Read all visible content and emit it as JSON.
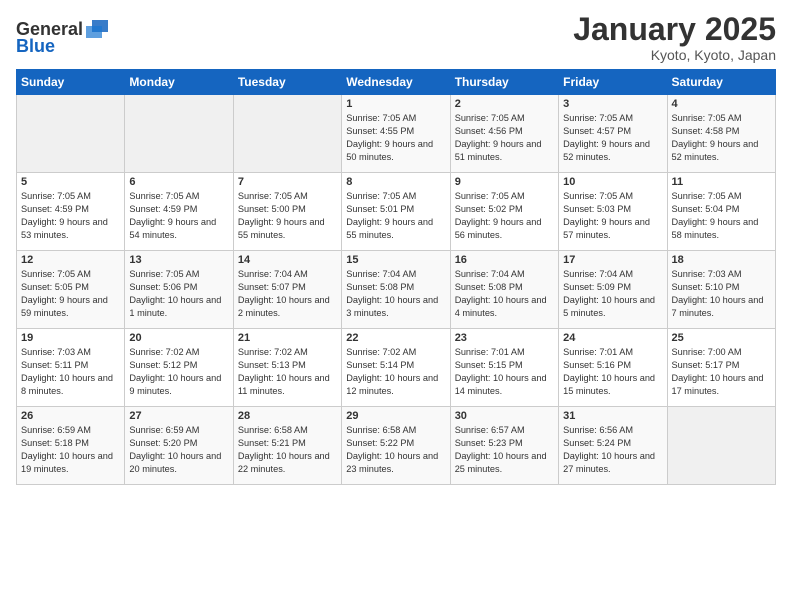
{
  "logo": {
    "line1": "General",
    "line2": "Blue"
  },
  "header": {
    "title": "January 2025",
    "location": "Kyoto, Kyoto, Japan"
  },
  "weekdays": [
    "Sunday",
    "Monday",
    "Tuesday",
    "Wednesday",
    "Thursday",
    "Friday",
    "Saturday"
  ],
  "weeks": [
    [
      {
        "day": "",
        "sunrise": "",
        "sunset": "",
        "daylight": ""
      },
      {
        "day": "",
        "sunrise": "",
        "sunset": "",
        "daylight": ""
      },
      {
        "day": "",
        "sunrise": "",
        "sunset": "",
        "daylight": ""
      },
      {
        "day": "1",
        "sunrise": "Sunrise: 7:05 AM",
        "sunset": "Sunset: 4:55 PM",
        "daylight": "Daylight: 9 hours and 50 minutes."
      },
      {
        "day": "2",
        "sunrise": "Sunrise: 7:05 AM",
        "sunset": "Sunset: 4:56 PM",
        "daylight": "Daylight: 9 hours and 51 minutes."
      },
      {
        "day": "3",
        "sunrise": "Sunrise: 7:05 AM",
        "sunset": "Sunset: 4:57 PM",
        "daylight": "Daylight: 9 hours and 52 minutes."
      },
      {
        "day": "4",
        "sunrise": "Sunrise: 7:05 AM",
        "sunset": "Sunset: 4:58 PM",
        "daylight": "Daylight: 9 hours and 52 minutes."
      }
    ],
    [
      {
        "day": "5",
        "sunrise": "Sunrise: 7:05 AM",
        "sunset": "Sunset: 4:59 PM",
        "daylight": "Daylight: 9 hours and 53 minutes."
      },
      {
        "day": "6",
        "sunrise": "Sunrise: 7:05 AM",
        "sunset": "Sunset: 4:59 PM",
        "daylight": "Daylight: 9 hours and 54 minutes."
      },
      {
        "day": "7",
        "sunrise": "Sunrise: 7:05 AM",
        "sunset": "Sunset: 5:00 PM",
        "daylight": "Daylight: 9 hours and 55 minutes."
      },
      {
        "day": "8",
        "sunrise": "Sunrise: 7:05 AM",
        "sunset": "Sunset: 5:01 PM",
        "daylight": "Daylight: 9 hours and 55 minutes."
      },
      {
        "day": "9",
        "sunrise": "Sunrise: 7:05 AM",
        "sunset": "Sunset: 5:02 PM",
        "daylight": "Daylight: 9 hours and 56 minutes."
      },
      {
        "day": "10",
        "sunrise": "Sunrise: 7:05 AM",
        "sunset": "Sunset: 5:03 PM",
        "daylight": "Daylight: 9 hours and 57 minutes."
      },
      {
        "day": "11",
        "sunrise": "Sunrise: 7:05 AM",
        "sunset": "Sunset: 5:04 PM",
        "daylight": "Daylight: 9 hours and 58 minutes."
      }
    ],
    [
      {
        "day": "12",
        "sunrise": "Sunrise: 7:05 AM",
        "sunset": "Sunset: 5:05 PM",
        "daylight": "Daylight: 9 hours and 59 minutes."
      },
      {
        "day": "13",
        "sunrise": "Sunrise: 7:05 AM",
        "sunset": "Sunset: 5:06 PM",
        "daylight": "Daylight: 10 hours and 1 minute."
      },
      {
        "day": "14",
        "sunrise": "Sunrise: 7:04 AM",
        "sunset": "Sunset: 5:07 PM",
        "daylight": "Daylight: 10 hours and 2 minutes."
      },
      {
        "day": "15",
        "sunrise": "Sunrise: 7:04 AM",
        "sunset": "Sunset: 5:08 PM",
        "daylight": "Daylight: 10 hours and 3 minutes."
      },
      {
        "day": "16",
        "sunrise": "Sunrise: 7:04 AM",
        "sunset": "Sunset: 5:08 PM",
        "daylight": "Daylight: 10 hours and 4 minutes."
      },
      {
        "day": "17",
        "sunrise": "Sunrise: 7:04 AM",
        "sunset": "Sunset: 5:09 PM",
        "daylight": "Daylight: 10 hours and 5 minutes."
      },
      {
        "day": "18",
        "sunrise": "Sunrise: 7:03 AM",
        "sunset": "Sunset: 5:10 PM",
        "daylight": "Daylight: 10 hours and 7 minutes."
      }
    ],
    [
      {
        "day": "19",
        "sunrise": "Sunrise: 7:03 AM",
        "sunset": "Sunset: 5:11 PM",
        "daylight": "Daylight: 10 hours and 8 minutes."
      },
      {
        "day": "20",
        "sunrise": "Sunrise: 7:02 AM",
        "sunset": "Sunset: 5:12 PM",
        "daylight": "Daylight: 10 hours and 9 minutes."
      },
      {
        "day": "21",
        "sunrise": "Sunrise: 7:02 AM",
        "sunset": "Sunset: 5:13 PM",
        "daylight": "Daylight: 10 hours and 11 minutes."
      },
      {
        "day": "22",
        "sunrise": "Sunrise: 7:02 AM",
        "sunset": "Sunset: 5:14 PM",
        "daylight": "Daylight: 10 hours and 12 minutes."
      },
      {
        "day": "23",
        "sunrise": "Sunrise: 7:01 AM",
        "sunset": "Sunset: 5:15 PM",
        "daylight": "Daylight: 10 hours and 14 minutes."
      },
      {
        "day": "24",
        "sunrise": "Sunrise: 7:01 AM",
        "sunset": "Sunset: 5:16 PM",
        "daylight": "Daylight: 10 hours and 15 minutes."
      },
      {
        "day": "25",
        "sunrise": "Sunrise: 7:00 AM",
        "sunset": "Sunset: 5:17 PM",
        "daylight": "Daylight: 10 hours and 17 minutes."
      }
    ],
    [
      {
        "day": "26",
        "sunrise": "Sunrise: 6:59 AM",
        "sunset": "Sunset: 5:18 PM",
        "daylight": "Daylight: 10 hours and 19 minutes."
      },
      {
        "day": "27",
        "sunrise": "Sunrise: 6:59 AM",
        "sunset": "Sunset: 5:20 PM",
        "daylight": "Daylight: 10 hours and 20 minutes."
      },
      {
        "day": "28",
        "sunrise": "Sunrise: 6:58 AM",
        "sunset": "Sunset: 5:21 PM",
        "daylight": "Daylight: 10 hours and 22 minutes."
      },
      {
        "day": "29",
        "sunrise": "Sunrise: 6:58 AM",
        "sunset": "Sunset: 5:22 PM",
        "daylight": "Daylight: 10 hours and 23 minutes."
      },
      {
        "day": "30",
        "sunrise": "Sunrise: 6:57 AM",
        "sunset": "Sunset: 5:23 PM",
        "daylight": "Daylight: 10 hours and 25 minutes."
      },
      {
        "day": "31",
        "sunrise": "Sunrise: 6:56 AM",
        "sunset": "Sunset: 5:24 PM",
        "daylight": "Daylight: 10 hours and 27 minutes."
      },
      {
        "day": "",
        "sunrise": "",
        "sunset": "",
        "daylight": ""
      }
    ]
  ]
}
